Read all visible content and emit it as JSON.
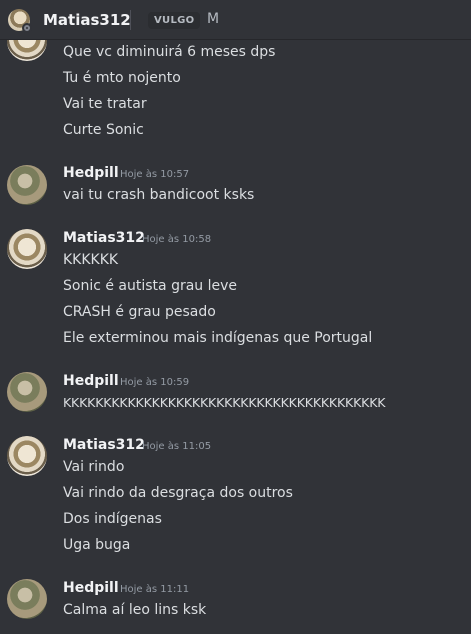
{
  "header": {
    "username": "Matias312",
    "tag": "VULGO",
    "tag_extra": "M"
  },
  "messages": [
    {
      "author": "",
      "lines": [
        "Que vc diminuirá 6 meses dps",
        "Tu é mto nojento",
        "Vai te tratar",
        "Curte Sonic"
      ]
    },
    {
      "author": "Hedpill",
      "time": "Hoje às 10:57",
      "lines": [
        "vai tu crash bandicoot ksks"
      ]
    },
    {
      "author": "Matias312",
      "time": "Hoje às 10:58",
      "lines": [
        "KKKKKK",
        "Sonic é autista grau leve",
        "CRASH é grau pesado",
        "Ele exterminou mais indígenas que Portugal"
      ]
    },
    {
      "author": "Hedpill",
      "time": "Hoje às 10:59",
      "lines": [
        "KKKKKKKKKKKKKKKKKKKKKKKKKKKKKKKKKKKKKKKK"
      ]
    },
    {
      "author": "Matias312",
      "time": "Hoje às 11:05",
      "lines": [
        "Vai rindo",
        "Vai rindo da desgraça dos outros",
        "Dos indígenas",
        "Uga buga"
      ]
    },
    {
      "author": "Hedpill",
      "time": "Hoje às 11:11",
      "lines": [
        "Calma aí leo lins ksk"
      ]
    }
  ]
}
